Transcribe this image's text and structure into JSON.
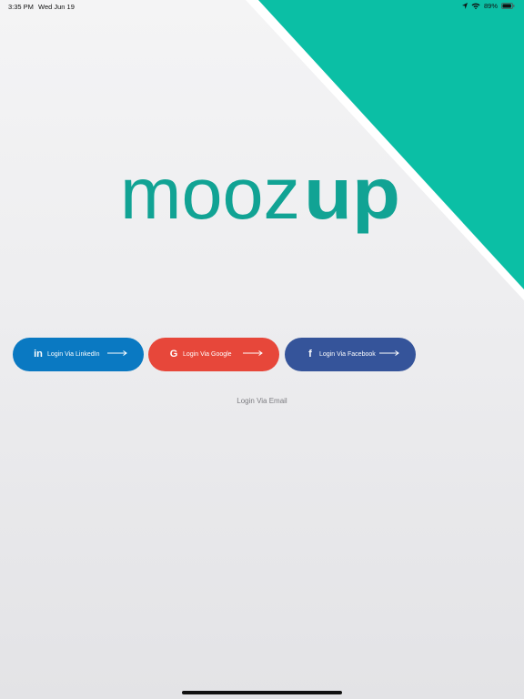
{
  "status_bar": {
    "time": "3:35 PM",
    "date": "Wed Jun 19",
    "battery": "89%"
  },
  "logo": {
    "part_light": "mooz",
    "part_bold": "up"
  },
  "buttons": {
    "linkedin": {
      "label": "Login Via LinkedIn",
      "icon_glyph": "in"
    },
    "google": {
      "label": "Login Via Google",
      "icon_glyph": "G"
    },
    "facebook": {
      "label": "Login Via Facebook",
      "icon_glyph": "f"
    }
  },
  "email_link": "Login Via Email",
  "colors": {
    "accent_teal": "#0bbfa5",
    "logo_teal": "#11a394",
    "linkedin": "#0a79c2",
    "google": "#e7473a",
    "facebook": "#35549a"
  }
}
